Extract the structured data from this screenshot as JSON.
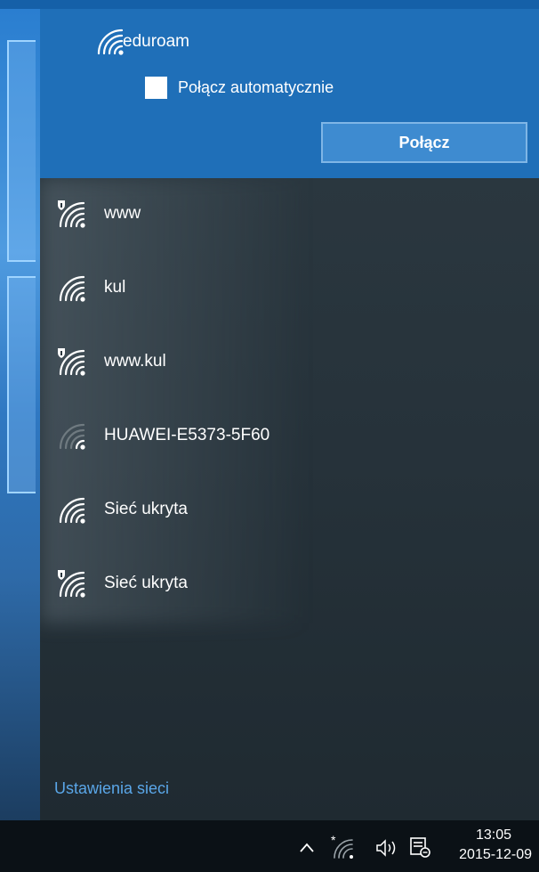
{
  "selected": {
    "name": "eduroam",
    "auto_connect_label": "Połącz automatycznie",
    "auto_connect_checked": false,
    "connect_label": "Połącz",
    "secured": false
  },
  "networks": [
    {
      "name": "www",
      "secured": true,
      "signal": "full"
    },
    {
      "name": "kul",
      "secured": false,
      "signal": "full"
    },
    {
      "name": "www.kul",
      "secured": true,
      "signal": "full"
    },
    {
      "name": "HUAWEI-E5373-5F60",
      "secured": false,
      "signal": "weak"
    },
    {
      "name": "Sieć ukryta",
      "secured": false,
      "signal": "full"
    },
    {
      "name": "Sieć ukryta",
      "secured": true,
      "signal": "full"
    }
  ],
  "settings_link": "Ustawienia sieci",
  "taskbar": {
    "time": "13:05",
    "date": "2015-12-09",
    "icons": [
      "chevron-up-icon",
      "wifi-icon",
      "speaker-icon",
      "action-center-icon"
    ]
  },
  "colors": {
    "accent": "#1f6fb8",
    "link": "#5aa6e8",
    "panel": "#26323a"
  }
}
